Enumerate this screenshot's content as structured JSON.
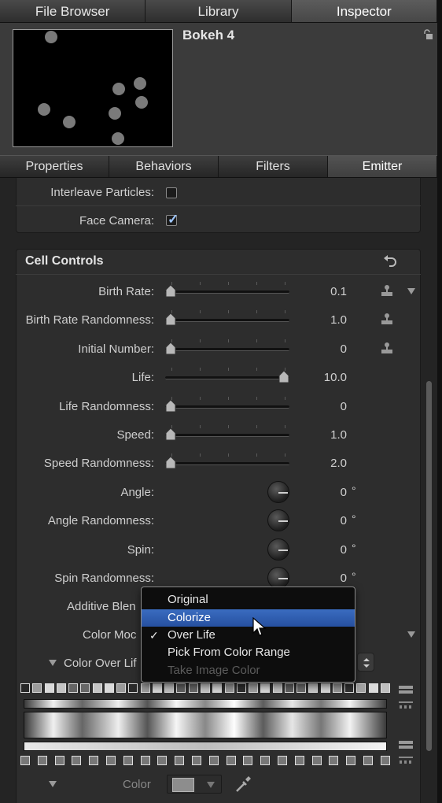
{
  "top_tabs": [
    "File Browser",
    "Library",
    "Inspector"
  ],
  "object_name": "Bokeh 4",
  "sub_tabs": [
    "Properties",
    "Behaviors",
    "Filters",
    "Emitter"
  ],
  "interleave_label": "Interleave Particles:",
  "interleave_checked": false,
  "face_camera_label": "Face Camera:",
  "face_camera_checked": true,
  "section_title": "Cell Controls",
  "rows": [
    {
      "label": "Birth Rate:",
      "value": "0.1",
      "control": "slider",
      "thumb": 0.0
    },
    {
      "label": "Birth Rate Randomness:",
      "value": "1.0",
      "control": "slider",
      "thumb": 0.0
    },
    {
      "label": "Initial Number:",
      "value": "0",
      "control": "slider",
      "thumb": 0.0
    },
    {
      "label": "Life:",
      "value": "10.0",
      "control": "slider",
      "thumb": 1.0
    },
    {
      "label": "Life Randomness:",
      "value": "0",
      "control": "slider",
      "thumb": 0.0
    },
    {
      "label": "Speed:",
      "value": "1.0",
      "control": "slider",
      "thumb": 0.0
    },
    {
      "label": "Speed Randomness:",
      "value": "2.0",
      "control": "slider",
      "thumb": 0.0
    },
    {
      "label": "Angle:",
      "value": "0",
      "control": "dial",
      "unit": "°"
    },
    {
      "label": "Angle Randomness:",
      "value": "0",
      "control": "dial",
      "unit": "°"
    },
    {
      "label": "Spin:",
      "value": "0",
      "control": "dial",
      "unit": "°"
    },
    {
      "label": "Spin Randomness:",
      "value": "0",
      "control": "dial",
      "unit": "°"
    }
  ],
  "additive_blend_label": "Additive Blen",
  "color_mode_label": "Color Moc",
  "color_over_life_label": "Color Over Lif",
  "color_label": "Color",
  "menu": {
    "items": [
      {
        "label": "Original",
        "state": "normal"
      },
      {
        "label": "Colorize",
        "state": "highlighted"
      },
      {
        "label": "Over Life",
        "state": "checked"
      },
      {
        "label": "Pick From Color Range",
        "state": "normal"
      },
      {
        "label": "Take Image Color",
        "state": "disabled"
      }
    ],
    "checkmark": "✓"
  },
  "colors": {
    "highlight": "#2f5fb3",
    "check_blue": "#9fc7ff",
    "panel_bg": "#2d2d2d"
  }
}
